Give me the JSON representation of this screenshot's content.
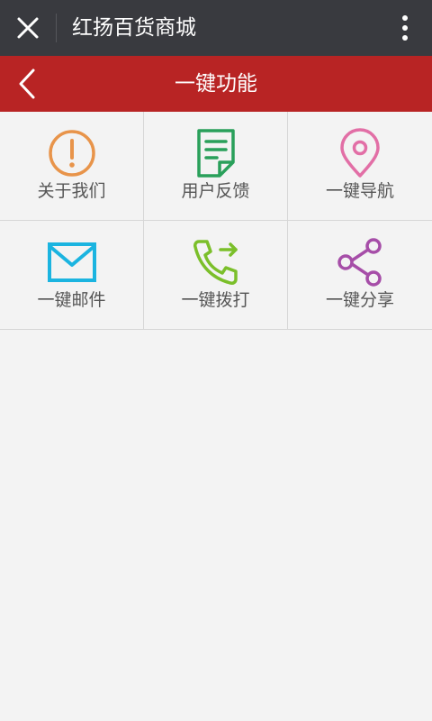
{
  "topbar": {
    "title": "红扬百货商城",
    "close_icon": "close-icon",
    "more_icon": "more-vertical-icon"
  },
  "header": {
    "title": "一键功能",
    "back_icon": "chevron-left-icon"
  },
  "colors": {
    "topbar": "#393a3f",
    "header": "#b82424",
    "about": "#e8944a",
    "feedback": "#29a05a",
    "navigate": "#e26fa6",
    "email": "#1bb4e0",
    "call": "#7bbf2a",
    "share": "#a64ea8"
  },
  "grid": {
    "items": [
      {
        "label": "关于我们",
        "icon": "info-alert-icon"
      },
      {
        "label": "用户反馈",
        "icon": "document-feedback-icon"
      },
      {
        "label": "一键导航",
        "icon": "location-pin-icon"
      },
      {
        "label": "一键邮件",
        "icon": "mail-icon"
      },
      {
        "label": "一键拨打",
        "icon": "phone-call-icon"
      },
      {
        "label": "一键分享",
        "icon": "share-icon"
      }
    ]
  }
}
